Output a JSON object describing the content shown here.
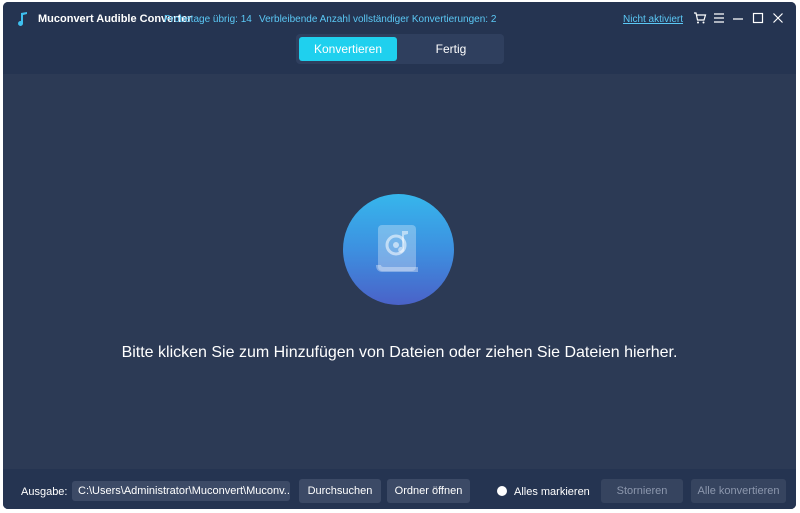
{
  "app": {
    "title": "Muconvert Audible Converter",
    "trial_days": "Probetage übrig: 14",
    "remaining_conversions": "Verbleibende Anzahl vollständiger Konvertierungen: 2",
    "activation_link": "Nicht aktiviert"
  },
  "window_controls": [
    "cart-icon",
    "menu-icon",
    "minimize-icon",
    "maximize-icon",
    "close-icon"
  ],
  "tabs": [
    {
      "label": "Konvertieren",
      "active": true
    },
    {
      "label": "Fertig",
      "active": false
    }
  ],
  "main": {
    "drop_hint": "Bitte klicken Sie zum Hinzufügen von Dateien oder ziehen Sie Dateien hierher.",
    "drop_icon": "audiobook-icon"
  },
  "footer": {
    "output_label": "Ausgabe:",
    "output_path": "C:\\Users\\Administrator\\Muconvert\\Muconv...",
    "browse_label": "Durchsuchen",
    "open_folder_label": "Ordner öffnen",
    "select_all_label": "Alles markieren",
    "cancel_label": "Stornieren",
    "convert_all_label": "Alle konvertieren"
  },
  "colors": {
    "background": "#2c3a55",
    "titlebar": "#253451",
    "accent": "#1fd0ee",
    "link": "#5bc8f5"
  }
}
